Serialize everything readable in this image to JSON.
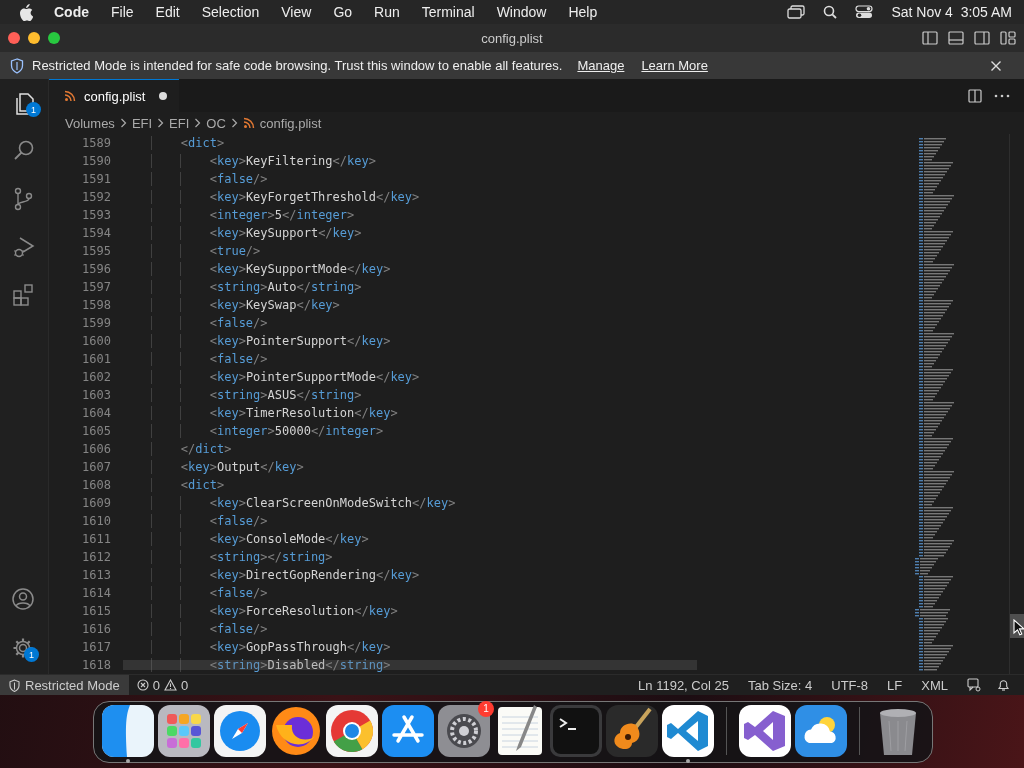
{
  "menu_bar": {
    "app": "Code",
    "items": [
      "File",
      "Edit",
      "Selection",
      "View",
      "Go",
      "Run",
      "Terminal",
      "Window",
      "Help"
    ],
    "clock": "Sat Nov 4  3:05 AM"
  },
  "window": {
    "title": "config.plist"
  },
  "banner": {
    "message": "Restricted Mode is intended for safe code browsing. Trust this window to enable all features.",
    "links": [
      "Manage",
      "Learn More"
    ]
  },
  "activity_bar": {
    "items": [
      {
        "kind": "explorer",
        "badge": "1",
        "selected": true
      },
      {
        "kind": "search",
        "selected": false
      },
      {
        "kind": "source-control",
        "selected": false
      },
      {
        "kind": "run-debug",
        "selected": false
      },
      {
        "kind": "extensions",
        "selected": false
      }
    ],
    "bottom": [
      {
        "kind": "accounts"
      },
      {
        "kind": "manage",
        "badge": "1"
      }
    ]
  },
  "tabs": [
    {
      "label": "config.plist",
      "selected": true,
      "modified": true
    }
  ],
  "breadcrumb": [
    "Volumes",
    "EFI",
    "EFI",
    "OC",
    "config.plist"
  ],
  "editor": {
    "lines": [
      {
        "number": "1589",
        "text": "        <dict>"
      },
      {
        "number": "1590",
        "text": "            <key>KeyFiltering</key>"
      },
      {
        "number": "1591",
        "text": "            <false/>"
      },
      {
        "number": "1592",
        "text": "            <key>KeyForgetThreshold</key>"
      },
      {
        "number": "1593",
        "text": "            <integer>5</integer>"
      },
      {
        "number": "1594",
        "text": "            <key>KeySupport</key>"
      },
      {
        "number": "1595",
        "text": "            <true/>"
      },
      {
        "number": "1596",
        "text": "            <key>KeySupportMode</key>"
      },
      {
        "number": "1597",
        "text": "            <string>Auto</string>"
      },
      {
        "number": "1598",
        "text": "            <key>KeySwap</key>"
      },
      {
        "number": "1599",
        "text": "            <false/>"
      },
      {
        "number": "1600",
        "text": "            <key>PointerSupport</key>"
      },
      {
        "number": "1601",
        "text": "            <false/>"
      },
      {
        "number": "1602",
        "text": "            <key>PointerSupportMode</key>"
      },
      {
        "number": "1603",
        "text": "            <string>ASUS</string>"
      },
      {
        "number": "1604",
        "text": "            <key>TimerResolution</key>"
      },
      {
        "number": "1605",
        "text": "            <integer>50000</integer>"
      },
      {
        "number": "1606",
        "text": "        </dict>"
      },
      {
        "number": "1607",
        "text": "        <key>Output</key>"
      },
      {
        "number": "1608",
        "text": "        <dict>"
      },
      {
        "number": "1609",
        "text": "            <key>ClearScreenOnModeSwitch</key>"
      },
      {
        "number": "1610",
        "text": "            <false/>"
      },
      {
        "number": "1611",
        "text": "            <key>ConsoleMode</key>"
      },
      {
        "number": "1612",
        "text": "            <string></string>"
      },
      {
        "number": "1613",
        "text": "            <key>DirectGopRendering</key>"
      },
      {
        "number": "1614",
        "text": "            <false/>"
      },
      {
        "number": "1615",
        "text": "            <key>ForceResolution</key>"
      },
      {
        "number": "1616",
        "text": "            <false/>"
      },
      {
        "number": "1617",
        "text": "            <key>GopPassThrough</key>"
      },
      {
        "number": "1618",
        "text": "            <string>Disabled</string>"
      }
    ]
  },
  "status_bar": {
    "mode": "Restricted Mode",
    "errors": "0",
    "warnings": "0",
    "items": [
      "Ln 1192, Col 25",
      "Tab Size: 4",
      "UTF-8",
      "LF",
      "XML"
    ]
  },
  "dock": {
    "apps": [
      {
        "kind": "finder",
        "running": true
      },
      {
        "kind": "launchpad",
        "running": false
      },
      {
        "kind": "safari",
        "running": false
      },
      {
        "kind": "firefox",
        "running": false
      },
      {
        "kind": "chrome",
        "running": false
      },
      {
        "kind": "app-store",
        "running": false
      },
      {
        "kind": "settings",
        "running": false,
        "badge": "1"
      },
      {
        "kind": "textedit",
        "running": false
      },
      {
        "kind": "terminal",
        "running": false
      },
      {
        "kind": "garageband",
        "running": false
      },
      {
        "kind": "vscode",
        "running": true
      },
      {
        "kind": "separator"
      },
      {
        "kind": "visual-studio",
        "running": false
      },
      {
        "kind": "weather",
        "running": false
      },
      {
        "kind": "separator"
      },
      {
        "kind": "trash",
        "running": false
      }
    ]
  }
}
